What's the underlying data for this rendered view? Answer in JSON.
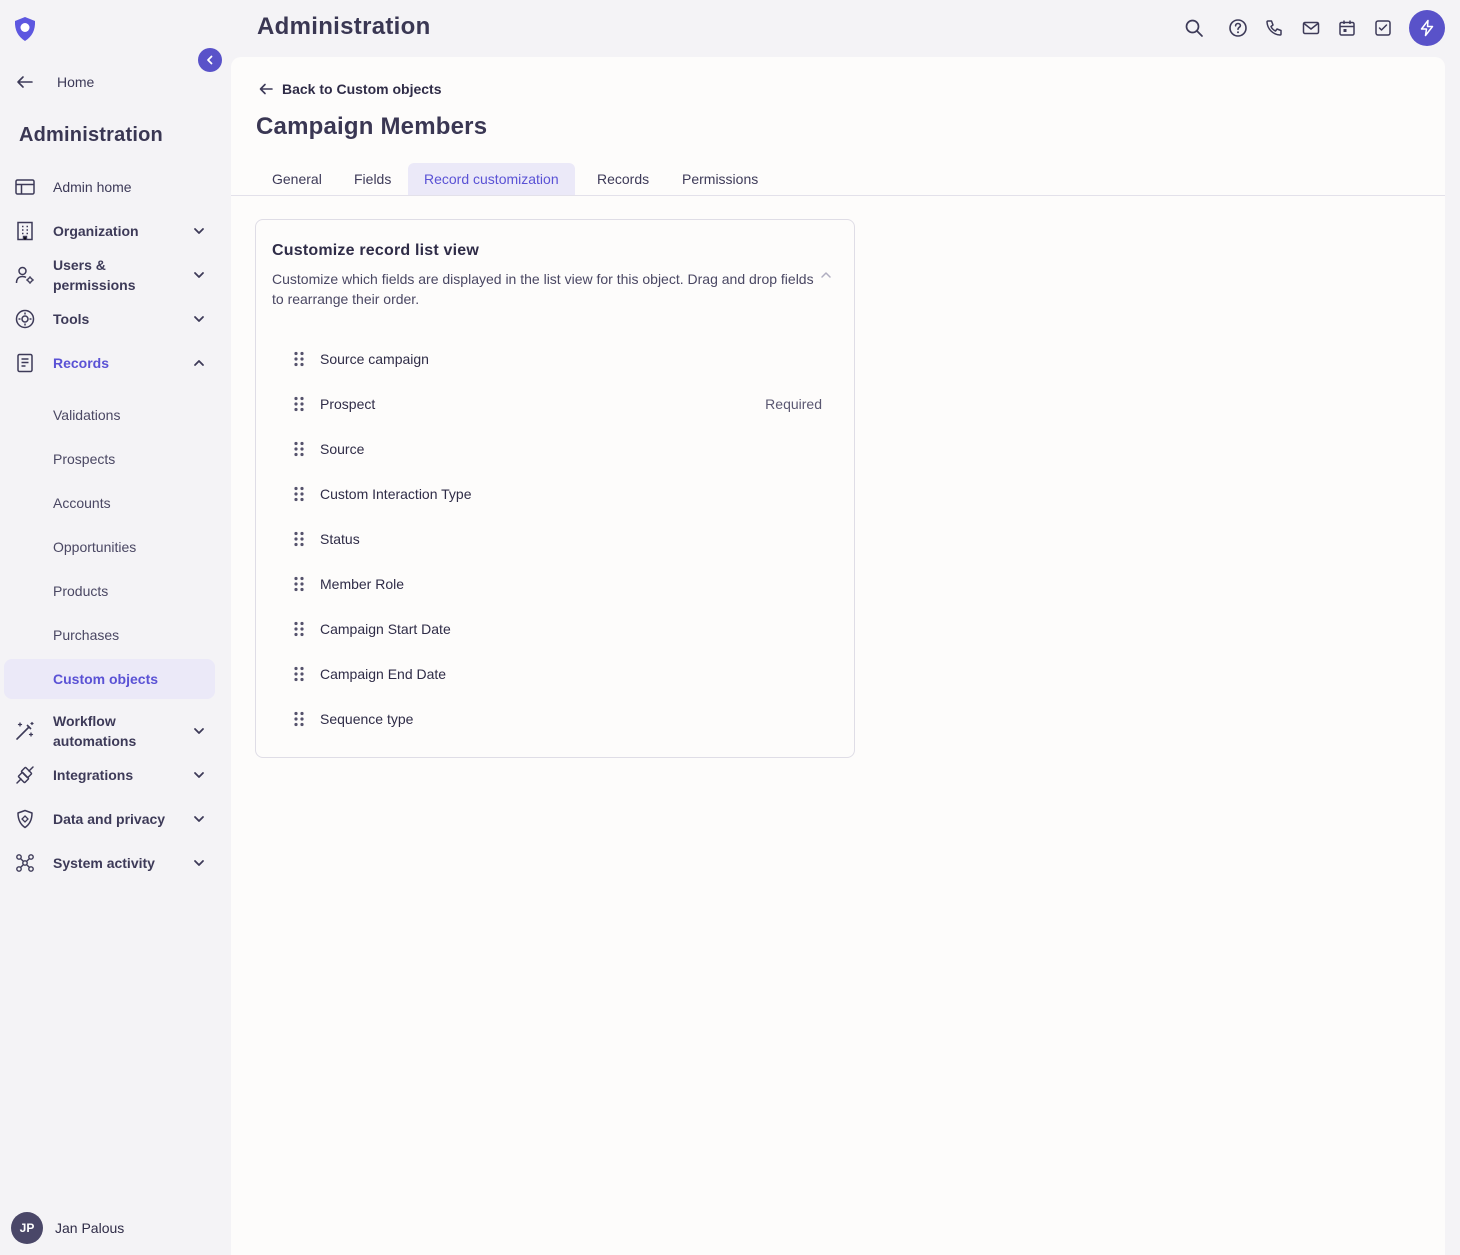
{
  "app": {
    "header_title": "Administration"
  },
  "sidebar": {
    "home_label": "Home",
    "title": "Administration",
    "nav": [
      {
        "label": "Admin home",
        "icon": "layout-icon"
      },
      {
        "label": "Organization",
        "icon": "building-icon"
      },
      {
        "label": "Users &\npermissions",
        "icon": "user-gear-icon"
      },
      {
        "label": "Tools",
        "icon": "tools-icon"
      },
      {
        "label": "Records",
        "icon": "document-icon"
      },
      {
        "label": "Workflow\nautomations",
        "icon": "magic-wand-icon"
      },
      {
        "label": "Integrations",
        "icon": "plug-icon"
      },
      {
        "label": "Data and privacy",
        "icon": "shield-icon"
      },
      {
        "label": "System activity",
        "icon": "network-icon"
      }
    ],
    "records_sub": [
      "Validations",
      "Prospects",
      "Accounts",
      "Opportunities",
      "Products",
      "Purchases",
      "Custom objects"
    ],
    "selected_sub": "Custom objects",
    "user": {
      "initials": "JP",
      "name": "Jan Palous"
    }
  },
  "topbar": {
    "icons": [
      "search-icon",
      "help-icon",
      "phone-icon",
      "mail-icon",
      "calendar-icon",
      "tasks-icon",
      "bolt-icon"
    ]
  },
  "main": {
    "back_label": "Back to Custom objects",
    "object_title": "Campaign Members",
    "tabs": [
      "General",
      "Fields",
      "Record customization",
      "Records",
      "Permissions"
    ],
    "active_tab": "Record customization",
    "card": {
      "title": "Customize record list view",
      "description": "Customize which fields are displayed in the list view for this object. Drag and drop fields to rearrange their order.",
      "fields": [
        {
          "name": "Source campaign",
          "badge": ""
        },
        {
          "name": "Prospect",
          "badge": "Required"
        },
        {
          "name": "Source",
          "badge": ""
        },
        {
          "name": "Custom Interaction Type",
          "badge": ""
        },
        {
          "name": "Status",
          "badge": ""
        },
        {
          "name": "Member Role",
          "badge": ""
        },
        {
          "name": "Campaign Start Date",
          "badge": ""
        },
        {
          "name": "Campaign End Date",
          "badge": ""
        },
        {
          "name": "Sequence type",
          "badge": ""
        }
      ]
    }
  },
  "colors": {
    "accent": "#5a52d5",
    "brand_button": "#5952c9",
    "text": "#2f2c47"
  }
}
